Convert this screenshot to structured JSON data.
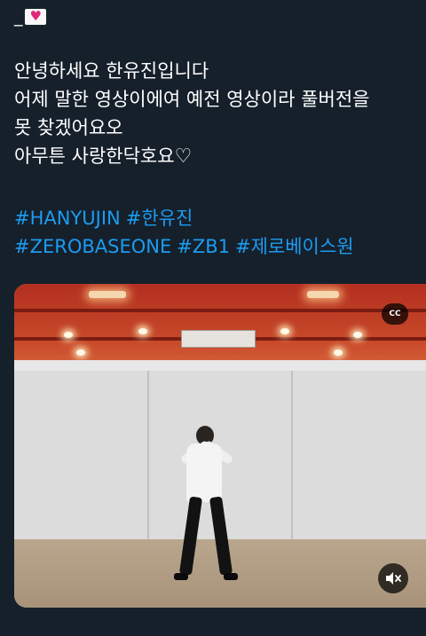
{
  "header": {
    "prefix": "_",
    "emoji_icon": "heart-letter-icon"
  },
  "tweet": {
    "lines": [
      "안녕하세요 한유진입니다",
      "어제 말한 영상이에여 예전 영상이라 풀버전을",
      "못 찾겠어요오",
      "아무튼 사랑한닥호요"
    ],
    "end_emoji_icon": "white-heart-icon",
    "hashtags_row1": [
      "#HANYUJIN",
      "#한유진"
    ],
    "hashtags_row2": [
      "#ZEROBASEONE",
      "#ZB1",
      "#제로베이스원"
    ]
  },
  "media": {
    "cc_label": "CC",
    "mute_icon": "speaker-muted-icon"
  },
  "colors": {
    "background": "#15202b",
    "text": "#ffffff",
    "hashtag": "#1d9bf0"
  }
}
